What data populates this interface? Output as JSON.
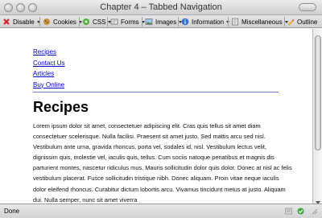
{
  "window": {
    "title": "Chapter 4 – Tabbed Navigation"
  },
  "toolbar": {
    "items": [
      {
        "label": "Disable",
        "icon": "disable-icon"
      },
      {
        "label": "Cookies",
        "icon": "cookies-icon"
      },
      {
        "label": "CSS",
        "icon": "css-icon"
      },
      {
        "label": "Forms",
        "icon": "forms-icon"
      },
      {
        "label": "Images",
        "icon": "images-icon"
      },
      {
        "label": "Information",
        "icon": "information-icon"
      },
      {
        "label": "Miscellaneous",
        "icon": "miscellaneous-icon"
      },
      {
        "label": "Outline",
        "icon": "outline-icon"
      }
    ]
  },
  "nav": {
    "links": [
      {
        "label": "Recipes"
      },
      {
        "label": "Contact Us"
      },
      {
        "label": "Articles"
      },
      {
        "label": "Buy Online"
      }
    ]
  },
  "main": {
    "heading": "Recipes",
    "paragraph": "Lorem ipsum dolor sit amet, consectetuer adipiscing elit. Cras quis tellus sit amet diam consectetuer scelerisque. Nulla facilisi. Praesent sit amet justo. Sed mattis arcu sed nisl. Vestibulum ante urna, gravida rhoncus, porta vel, sodales id, nisl. Vestibulum lectus velit, dignissim quis, molestie vel, iaculis quis, tellus. Cum sociis natoque penatibus et magnis dis parturient montes, nascetur ridiculus mus. Mauris sollicitudin dolor quis dolor. Donec at nisl ac felis vestibulum placerat. Fusce sollicitudin tristique nibh. Donec aliquam. Proin vitae neque iaculis dolor eleifend rhoncus. Curabitur dictum lobortis arcu. Vivamus tincidunt metus at justo. Aliquam dui. Nulla semper, nunc sit amet viverra"
  },
  "status": {
    "text": "Done"
  },
  "colors": {
    "link": "#0000cc",
    "nav_rule": "#6b7bd6"
  }
}
